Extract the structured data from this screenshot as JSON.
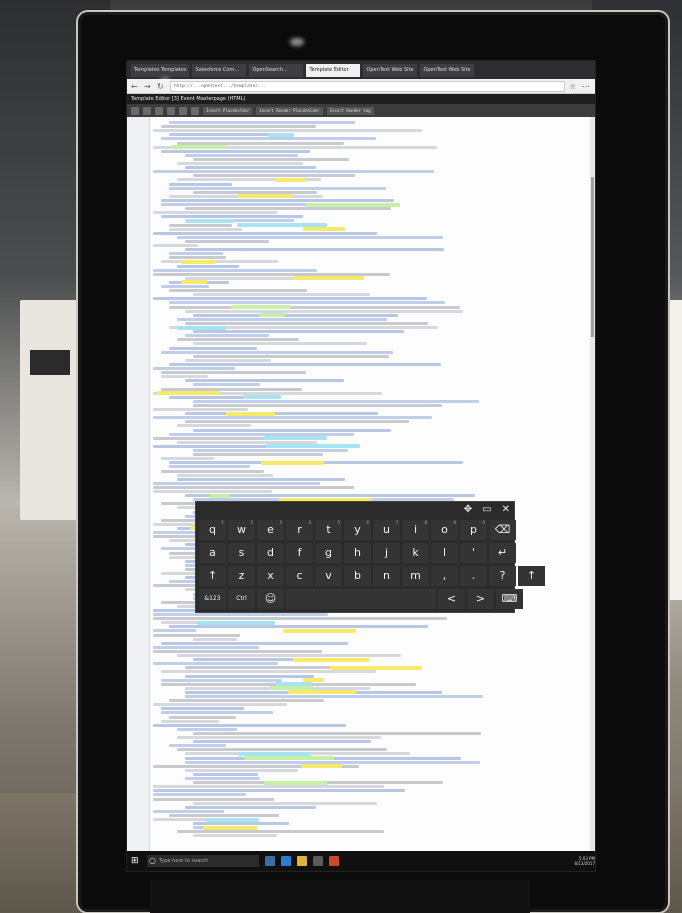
{
  "browser": {
    "tabs": [
      "Templates Templates",
      "Salesforce Com...",
      "OpenSearch...",
      "Template Editor",
      "OpenText Web Site",
      "OpenText Web Site"
    ],
    "active_tab_index": 3,
    "url": "http://...opentext.../template/...",
    "app_title": "Template Editor [3] Event Masterpage (HTML)"
  },
  "toolbar": {
    "field_1": "Insert Placeholder",
    "field_2": "Insert Render Placeholder",
    "field_3": "Insert Render tag"
  },
  "keyboard": {
    "top_icons": [
      "✥",
      "▭",
      "✕"
    ],
    "row1": [
      [
        "q",
        "1"
      ],
      [
        "w",
        "2"
      ],
      [
        "e",
        "3"
      ],
      [
        "r",
        "4"
      ],
      [
        "t",
        "5"
      ],
      [
        "y",
        "6"
      ],
      [
        "u",
        "7"
      ],
      [
        "i",
        "8"
      ],
      [
        "o",
        "9"
      ],
      [
        "p",
        "0"
      ],
      [
        "⌫",
        ""
      ]
    ],
    "row2": [
      [
        "a",
        ""
      ],
      [
        "s",
        ""
      ],
      [
        "d",
        ""
      ],
      [
        "f",
        ""
      ],
      [
        "g",
        ""
      ],
      [
        "h",
        ""
      ],
      [
        "j",
        ""
      ],
      [
        "k",
        ""
      ],
      [
        "l",
        ""
      ],
      [
        "'",
        ""
      ],
      [
        "↵",
        ""
      ]
    ],
    "row3": [
      [
        "↑",
        ""
      ],
      [
        "z",
        ""
      ],
      [
        "x",
        ""
      ],
      [
        "c",
        ""
      ],
      [
        "v",
        ""
      ],
      [
        "b",
        ""
      ],
      [
        "n",
        ""
      ],
      [
        "m",
        ""
      ],
      [
        ",",
        ""
      ],
      [
        ".",
        ""
      ],
      [
        "?",
        ""
      ],
      [
        "↑",
        ""
      ]
    ],
    "row4": [
      "&123",
      "Ctrl",
      "☺",
      "",
      "<",
      ">",
      "⌨"
    ]
  },
  "taskbar": {
    "search_placeholder": "Type here to search",
    "time": "5:03 PM",
    "date": "6/13/2017"
  },
  "colors": {
    "highlight_yellow": "#f5ea6a",
    "highlight_cyan": "#a9e3f2",
    "highlight_green": "#c6f0a8",
    "code_blue": "#5a7fc2",
    "code_dark": "#555b66"
  }
}
